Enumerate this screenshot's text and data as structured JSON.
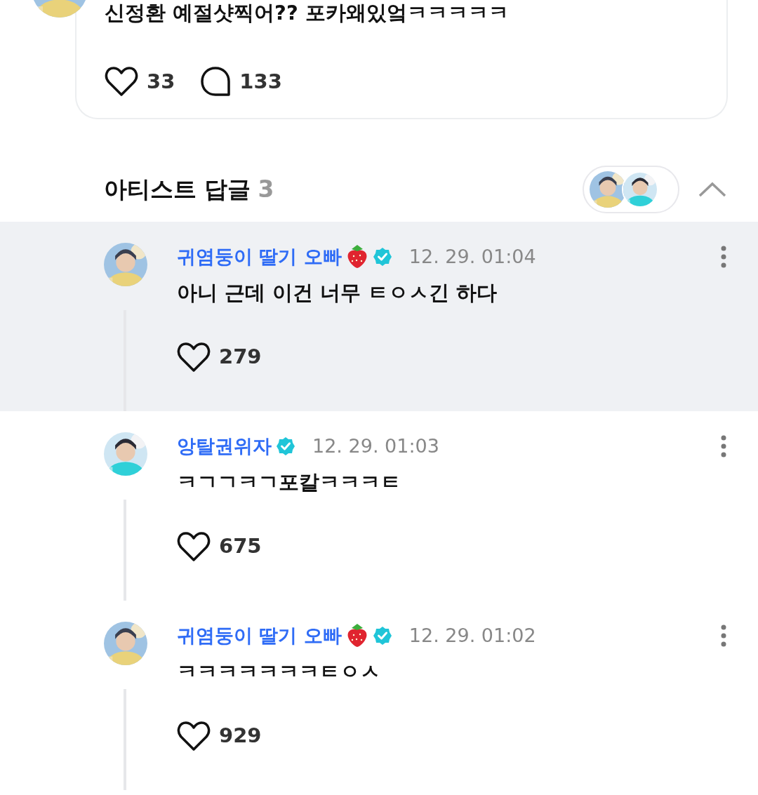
{
  "post": {
    "text": "신정환 예절샷찍어?? 포카왜있엌ㅋㅋㅋㅋㅋ",
    "likes": "33",
    "comments": "133"
  },
  "artist_replies": {
    "title": "아티스트 답글",
    "count": "3",
    "expanded": true,
    "replies": [
      {
        "author": "귀염둥이 딸기 오빠",
        "verified": true,
        "time": "12. 29. 01:04",
        "text": "아니 근데 이건 너무 ㅌㅇㅅ긴 하다",
        "likes": "279",
        "highlighted": true
      },
      {
        "author": "앙탈권위자",
        "verified": true,
        "time": "12. 29. 01:03",
        "text": "ㅋㄱㄱㅋㄱ포칼ㅋㅋㅋㅌ",
        "likes": "675",
        "highlighted": false
      },
      {
        "author": "귀염둥이 딸기 오빠",
        "verified": true,
        "time": "12. 29. 01:02",
        "text": "ㅋㅋㅋㅋㅋㅋㅋㅌㅇㅅ",
        "likes": "929",
        "highlighted": false
      }
    ]
  }
}
